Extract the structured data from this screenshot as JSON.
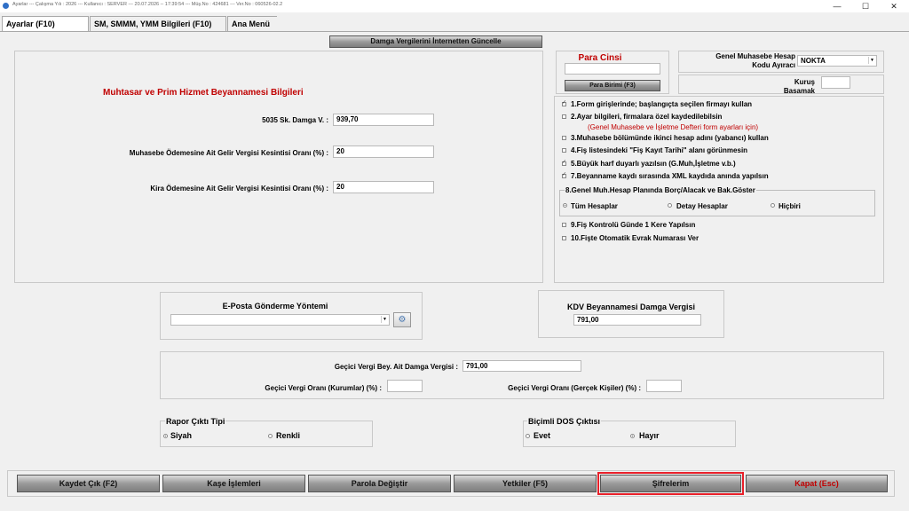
{
  "window": {
    "title": "Ayarlar  ---  Çalışma Yılı : 2026  ---  Kullanıcı : SERVER  ---  20.07.2026 -- 17:39:54  ---  Müş.No : 424681  ---  Ver.No : 060526-02.2",
    "minimize": "—",
    "maximize": "☐",
    "close": "✕"
  },
  "tabs": [
    {
      "label": "Ayarlar (F10)"
    },
    {
      "label": "SM, SMMM, YMM Bilgileri (F10)"
    },
    {
      "label": "Ana Menü"
    }
  ],
  "damga_update_button": "Damga Vergilerini İnternetten Güncelle",
  "muhtasar": {
    "title": "Muhtasar ve Prim Hizmet Beyannamesi Bilgileri",
    "fields": [
      {
        "label": "5035 Sk. Damga V. :",
        "value": "939,70"
      },
      {
        "label": "Muhasebe Ödemesine Ait Gelir Vergisi Kesintisi Oranı (%) :",
        "value": "20"
      },
      {
        "label": "Kira Ödemesine Ait Gelir Vergisi Kesintisi Oranı (%) :",
        "value": "20"
      }
    ]
  },
  "para_cinsi": {
    "title": "Para Cinsi",
    "value": "",
    "button": "Para Birimi (F3)"
  },
  "hesap_ayirac": {
    "label_line1": "Genel Muhasebe Hesap",
    "label_line2": "Kodu Ayıracı",
    "value": "NOKTA"
  },
  "kurus": {
    "label_line1": "Kuruş",
    "label_line2": "Basamak",
    "value": ""
  },
  "options": [
    {
      "label": "1.Form girişlerinde; başlangıçta seçilen firmayı kullan",
      "checked": true
    },
    {
      "label": "2.Ayar bilgileri, firmalara özel kaydedilebilsin",
      "checked": false,
      "note": "(Genel Muhasebe ve İşletme Defteri form ayarları için)"
    },
    {
      "label": "3.Muhasebe bölümünde ikinci hesap adını (yabancı) kullan",
      "checked": false
    },
    {
      "label": "4.Fiş listesindeki \"Fiş Kayıt Tarihi\" alanı görünmesin",
      "checked": false
    },
    {
      "label": "5.Büyük harf duyarlı yazılsın (G.Muh,İşletme v.b.)",
      "checked": true
    },
    {
      "label": "7.Beyanname kaydı sırasında XML kaydıda anında yapılsın",
      "checked": true
    }
  ],
  "borc_alacak": {
    "title": "8.Genel Muh.Hesap Planında Borç/Alacak ve Bak.Göster",
    "choices": [
      {
        "label": "Tüm Hesaplar",
        "selected": true
      },
      {
        "label": "Detay Hesaplar",
        "selected": false
      },
      {
        "label": "Hiçbiri",
        "selected": false
      }
    ]
  },
  "options_more": [
    {
      "label": "9.Fiş Kontrolü Günde 1 Kere Yapılsın",
      "checked": false
    },
    {
      "label": "10.Fişte Otomatik Evrak Numarası Ver",
      "checked": false
    }
  ],
  "eposta": {
    "title": "E-Posta Gönderme Yöntemi",
    "value": ""
  },
  "kdv": {
    "title": "KDV Beyannamesi  Damga Vergisi",
    "value": "791,00"
  },
  "gecici": {
    "damga_label": "Geçici Vergi Bey. Ait Damga Vergisi :",
    "damga_value": "791,00",
    "kurumlar_label": "Geçici Vergi Oranı (Kurumlar) (%) :",
    "kurumlar_value": "",
    "gercek_label": "Geçici Vergi Oranı (Gerçek Kişiler) (%) :",
    "gercek_value": ""
  },
  "rapor": {
    "title": "Rapor Çıktı Tipi",
    "choices": [
      {
        "label": "Siyah",
        "selected": true
      },
      {
        "label": "Renkli",
        "selected": false
      }
    ]
  },
  "dos": {
    "title": "Biçimli DOS Çıktısı",
    "choices": [
      {
        "label": "Evet",
        "selected": false
      },
      {
        "label": "Hayır",
        "selected": true
      }
    ]
  },
  "buttons": {
    "kaydet": "Kaydet Çık (F2)",
    "kase": "Kaşe İşlemleri",
    "parola": "Parola Değiştir",
    "yetkiler": "Yetkiler (F5)",
    "sifrelerim": "Şifrelerim",
    "kapat": "Kapat (Esc)"
  },
  "colors": {
    "accent_red": "#c00000",
    "highlight_border": "#e8202a",
    "button_gray": "#8a8a8a"
  }
}
